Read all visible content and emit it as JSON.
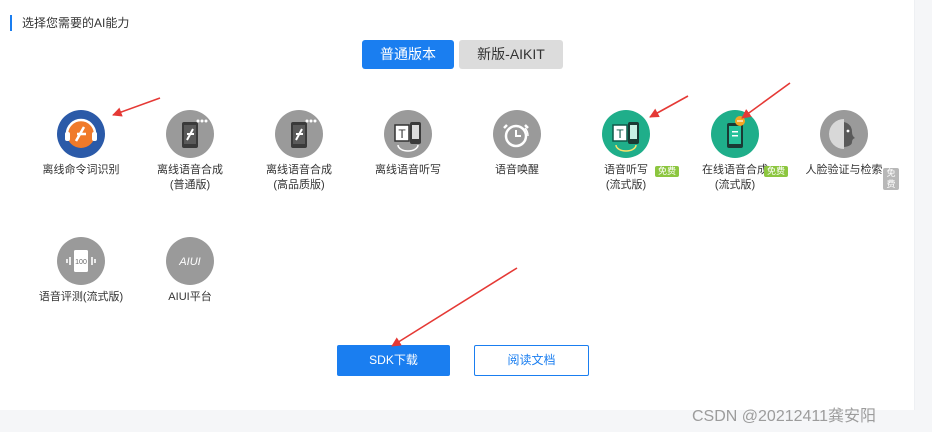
{
  "section_title": "选择您需要的AI能力",
  "tabs": [
    {
      "label": "普通版本",
      "active": true
    },
    {
      "label": "新版-AIKIT",
      "active": false
    }
  ],
  "capabilities": [
    {
      "line1": "离线命令词识别",
      "line2": "",
      "icon": "offline-command-icon",
      "color": "#2b5aa8"
    },
    {
      "line1": "离线语音合成",
      "line2": "(普通版)",
      "icon": "phone-synthesis-icon",
      "color": "#9a9a9a"
    },
    {
      "line1": "离线语音合成",
      "line2": "(高品质版)",
      "icon": "phone-synthesis-icon",
      "color": "#9a9a9a"
    },
    {
      "line1": "离线语音听写",
      "line2": "",
      "icon": "dictation-icon",
      "color": "#9a9a9a"
    },
    {
      "line1": "语音唤醒",
      "line2": "",
      "icon": "wake-clock-icon",
      "color": "#9a9a9a"
    },
    {
      "line1": "语音听写",
      "line2": "(流式版)",
      "icon": "dictation-icon",
      "color": "#1fae8a",
      "badge": "免费"
    },
    {
      "line1": "在线语音合成",
      "line2": "(流式版)",
      "icon": "phone-synthesis-icon",
      "color": "#1fae8a",
      "badge": "免费"
    },
    {
      "line1": "人脸验证与检索",
      "line2": "",
      "icon": "face-icon",
      "color": "#9a9a9a",
      "badge": "免费"
    },
    {
      "line1": "语音评测(流式版)",
      "line2": "",
      "icon": "evaluation-icon",
      "color": "#9a9a9a"
    },
    {
      "line1": "AIUI平台",
      "line2": "",
      "icon": "aiui-icon",
      "color": "#9a9a9a"
    }
  ],
  "buttons": {
    "sdk_download": "SDK下载",
    "read_docs": "阅读文档"
  },
  "watermark": "CSDN @20212411龚安阳",
  "accent_color": "#1a7ef0",
  "arrow_color": "#e53935"
}
